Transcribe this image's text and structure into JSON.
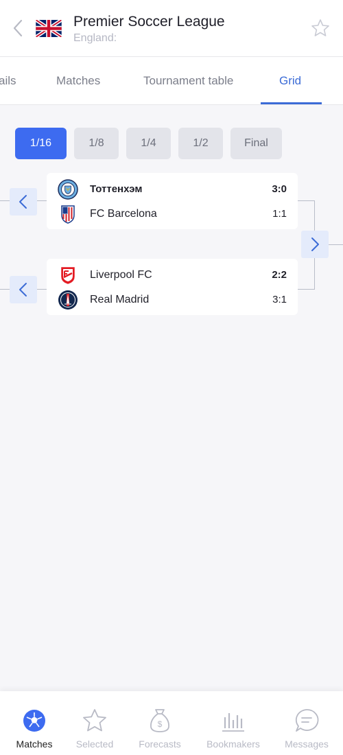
{
  "header": {
    "title": "Premier Soccer League",
    "subtitle": "England:"
  },
  "tabs": [
    {
      "label": "ails"
    },
    {
      "label": "Matches"
    },
    {
      "label": "Tournament table"
    },
    {
      "label": "Grid",
      "active": true
    }
  ],
  "rounds": [
    {
      "label": "1/16",
      "active": true
    },
    {
      "label": "1/8"
    },
    {
      "label": "1/4"
    },
    {
      "label": "1/2"
    },
    {
      "label": "Final"
    }
  ],
  "matches": [
    {
      "home": {
        "name": "Тоттенхэм",
        "score": "3:0",
        "logo": "manchester-city-logo"
      },
      "away": {
        "name": "FC Barcelona",
        "score": "1:1",
        "logo": "atletico-madrid-logo"
      }
    },
    {
      "home": {
        "name": "Liverpool FC",
        "score": "2:2",
        "logo": "fc-utrecht-logo"
      },
      "away": {
        "name": "Real Madrid",
        "score": "3:1",
        "logo": "psg-logo"
      }
    }
  ],
  "bottom_nav": [
    {
      "label": "Matches",
      "icon": "soccer-ball-icon",
      "active": true
    },
    {
      "label": "Selected",
      "icon": "star-icon"
    },
    {
      "label": "Forecasts",
      "icon": "money-bag-icon"
    },
    {
      "label": "Bookmakers",
      "icon": "bar-chart-icon"
    },
    {
      "label": "Messages",
      "icon": "chat-bubble-icon"
    }
  ],
  "colors": {
    "accent": "#3d6bf0",
    "tab_active": "#3b6bd6",
    "background": "#f6f6f9",
    "nav_button_bg": "#e4ebfb"
  }
}
